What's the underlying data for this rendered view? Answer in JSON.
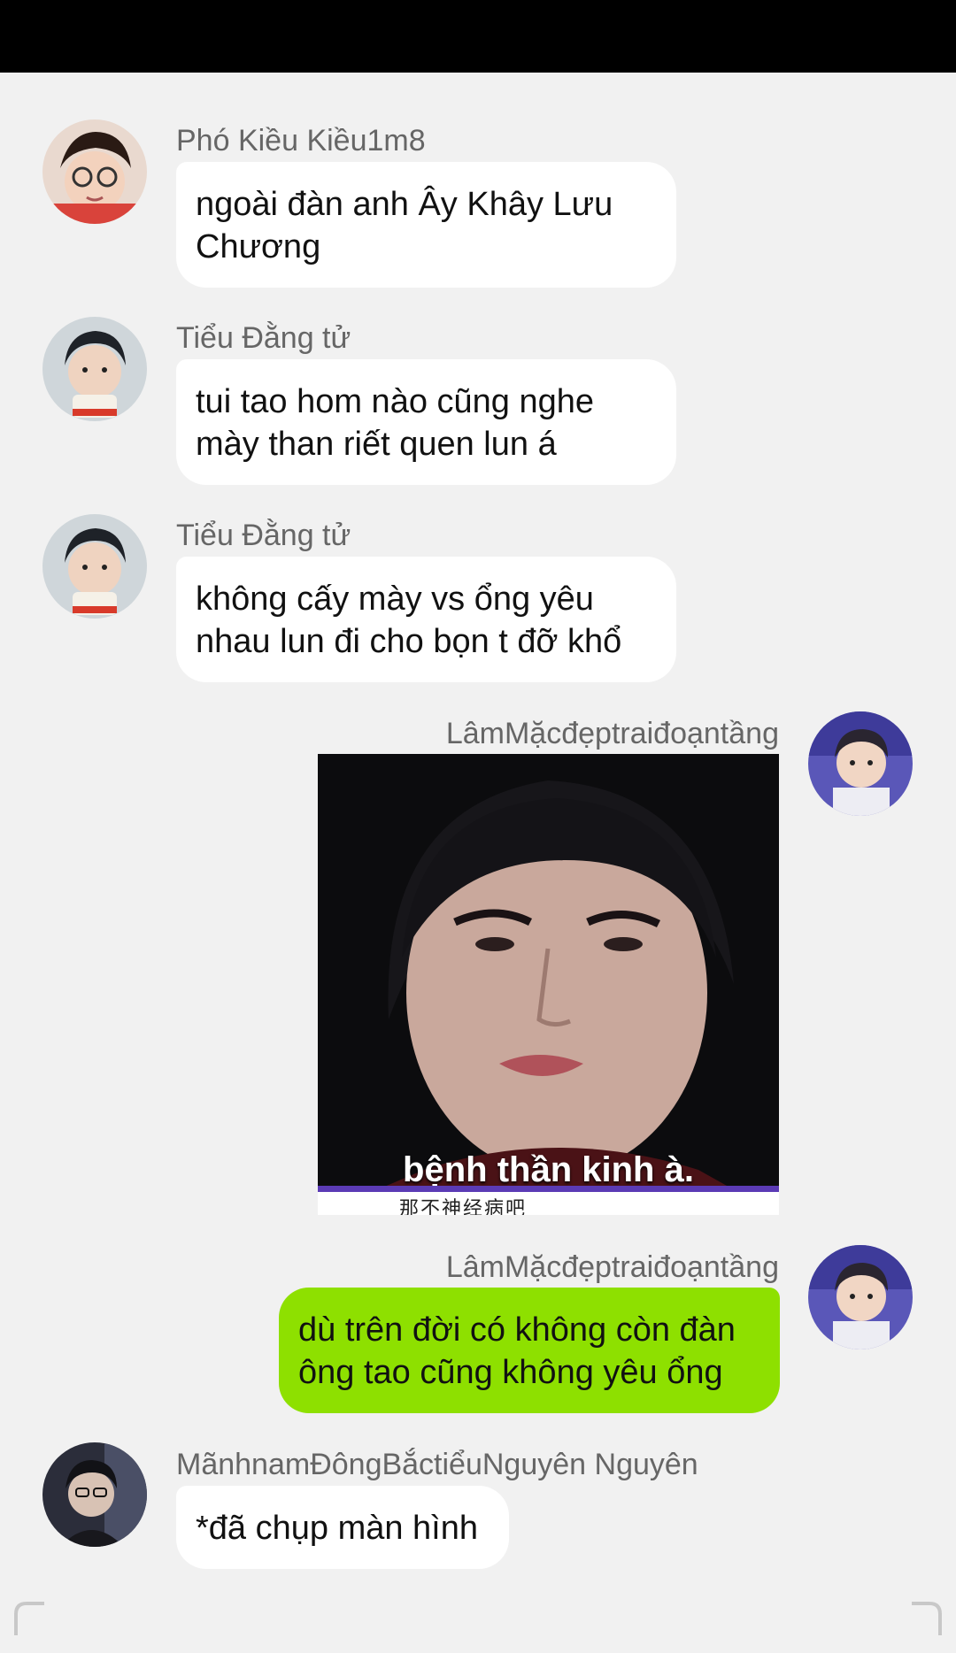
{
  "messages": [
    {
      "sender": "Phó Kiều Kiều1m8",
      "text": "ngoài đàn anh Ây Khây Lưu Chương",
      "avatar": "avatar-glasses-boy"
    },
    {
      "sender": "Tiểu Đằng tử",
      "text": "tui tao hom nào cũng nghe mày than riết quen lun á",
      "avatar": "avatar-boy-cup"
    },
    {
      "sender": "Tiểu Đằng tử",
      "text": "không cấy mày vs ổng yêu nhau lun đi cho bọn t đỡ khổ",
      "avatar": "avatar-boy-cup"
    },
    {
      "sender": "LâmMặcđẹptraiđoạntầng",
      "image_caption": "bệnh thần kinh à.",
      "image_caption_cn": "那不神经病吧",
      "avatar": "avatar-boy-purple"
    },
    {
      "sender": "LâmMặcđẹptraiđoạntầng",
      "text": "dù trên đời có không còn đàn ông tao cũng không yêu ổng",
      "avatar": "avatar-boy-purple"
    },
    {
      "sender": "MãnhnamĐôngBắctiểuNguyên Nguyên",
      "text": "*đã chụp màn hình",
      "avatar": "avatar-boy-dark"
    }
  ],
  "colors": {
    "background": "#f1f1f1",
    "incoming_bubble": "#ffffff",
    "outgoing_bubble": "#8ee000"
  }
}
